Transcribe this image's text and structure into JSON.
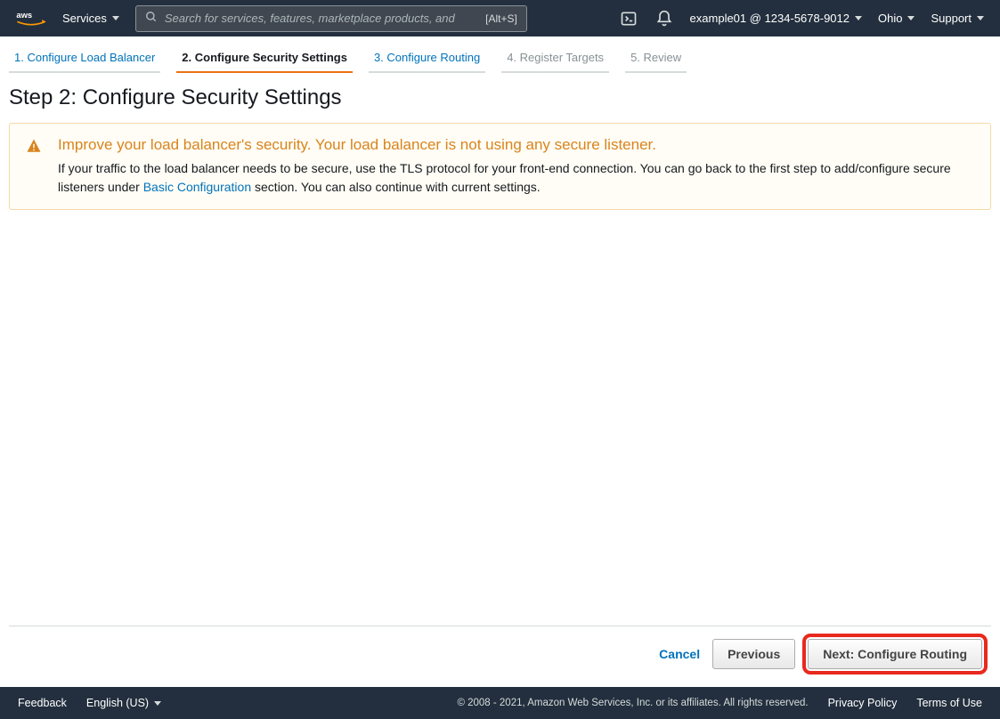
{
  "topnav": {
    "services_label": "Services",
    "search_placeholder": "Search for services, features, marketplace products, and",
    "search_hotkey": "[Alt+S]",
    "account_label": "example01 @ 1234-5678-9012",
    "region_label": "Ohio",
    "support_label": "Support"
  },
  "wizard": {
    "tabs": [
      {
        "label": "1. Configure Load Balancer",
        "state": "link"
      },
      {
        "label": "2. Configure Security Settings",
        "state": "active"
      },
      {
        "label": "3. Configure Routing",
        "state": "link"
      },
      {
        "label": "4. Register Targets",
        "state": "disabled"
      },
      {
        "label": "5. Review",
        "state": "disabled"
      }
    ]
  },
  "page": {
    "heading": "Step 2: Configure Security Settings",
    "alert": {
      "title": "Improve your load balancer's security. Your load balancer is not using any secure listener.",
      "text_before_link": "If your traffic to the load balancer needs to be secure, use the TLS protocol for your front-end connection. You can go back to the first step to add/configure secure listeners under ",
      "link_label": "Basic Configuration",
      "text_after_link": " section. You can also continue with current settings."
    }
  },
  "actions": {
    "cancel": "Cancel",
    "previous": "Previous",
    "next": "Next: Configure Routing"
  },
  "footer": {
    "feedback": "Feedback",
    "language": "English (US)",
    "copyright": "© 2008 - 2021, Amazon Web Services, Inc. or its affiliates. All rights reserved.",
    "privacy": "Privacy Policy",
    "terms": "Terms of Use"
  }
}
